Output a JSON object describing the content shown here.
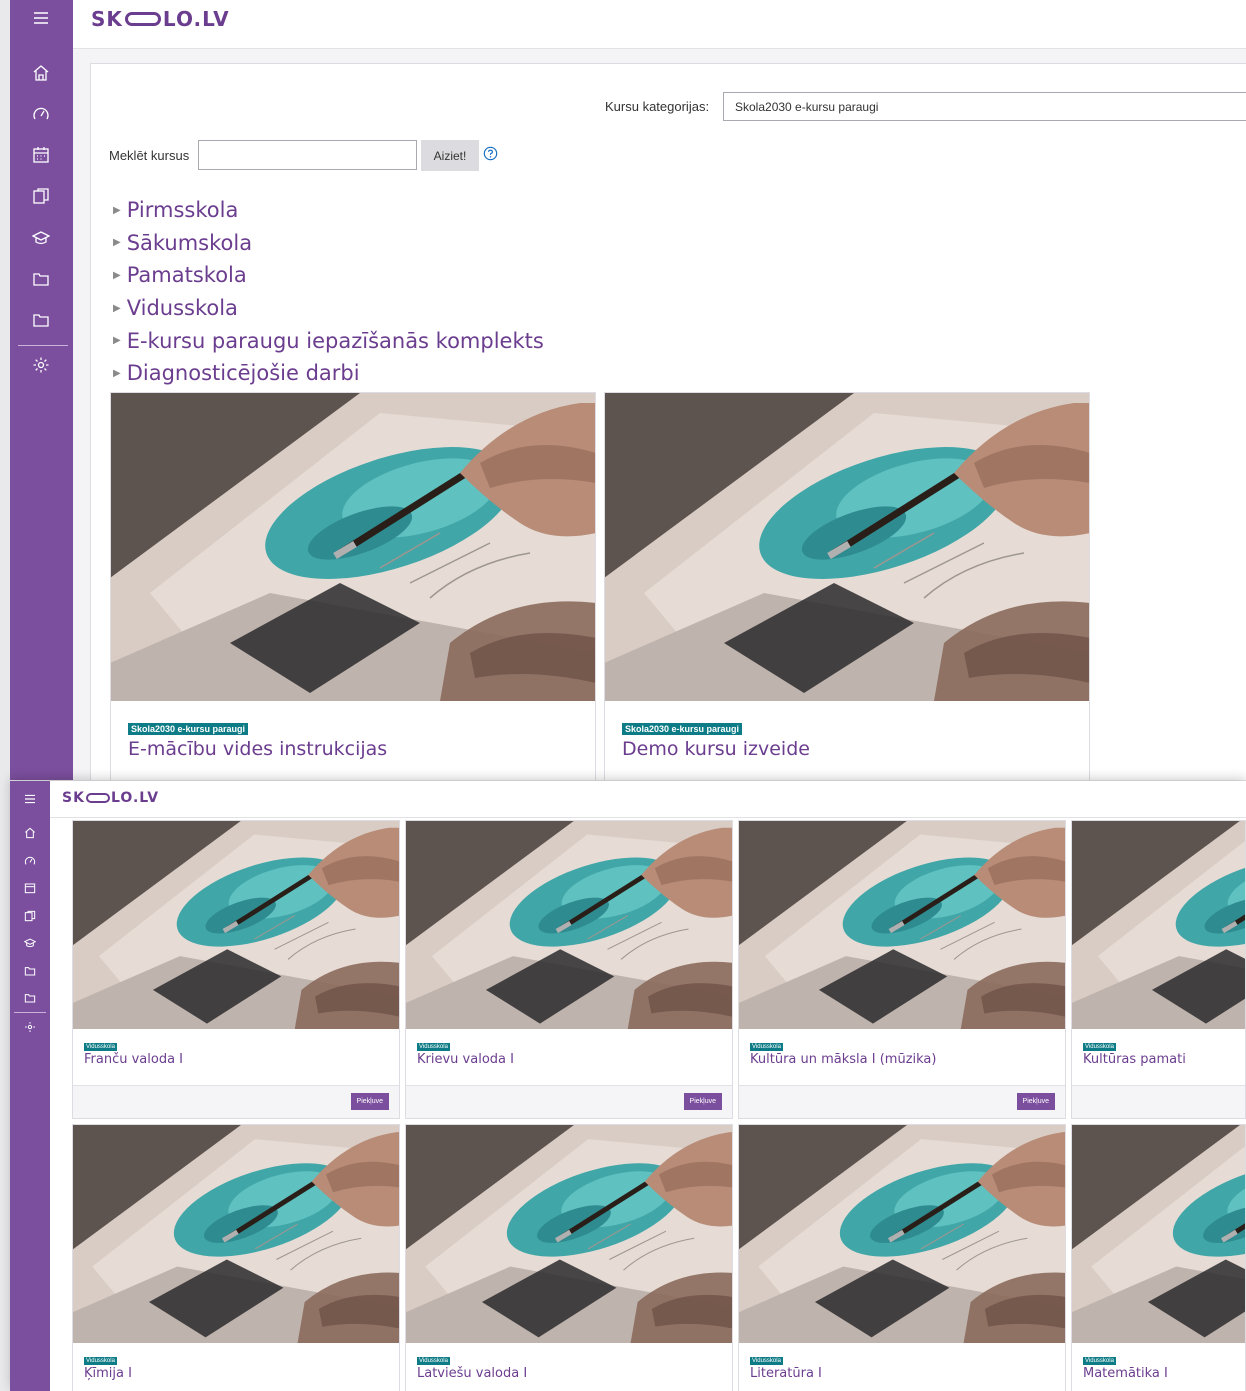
{
  "brand": {
    "left": "SK",
    "right": "LO.LV",
    "color": "#6b3d8f"
  },
  "colors": {
    "sidebar": "#7b4f9e",
    "badge": "#0e7c86",
    "accent": "#6b3d8f"
  },
  "sidebar_icons": [
    "menu-icon",
    "home-icon",
    "dashboard-icon",
    "calendar-icon",
    "files-icon",
    "graduation-cap-icon",
    "folder-icon",
    "folder-icon",
    "gear-icon"
  ],
  "filter": {
    "category_label": "Kursu kategorijas:",
    "category_value": "Skola2030 e-kursu paraugi"
  },
  "search": {
    "label": "Meklēt kursus",
    "value": "",
    "button": "Aiziet!"
  },
  "categories": [
    "Pirmsskola",
    "Sākumskola",
    "Pamatskola",
    "Vidusskola",
    "E-kursu paraugu iepazīšanās komplekts",
    "Diagnosticējošie darbi"
  ],
  "featured_courses": [
    {
      "badge": "Skola2030 e-kursu paraugi",
      "title": "E-mācību vides instrukcijas"
    },
    {
      "badge": "Skola2030 e-kursu paraugi",
      "title": "Demo kursu izveide"
    }
  ],
  "courses_row1": [
    {
      "badge": "Vidusskola",
      "title": "Franču valoda I",
      "button": "Piekļuve"
    },
    {
      "badge": "Vidusskola",
      "title": "Krievu valoda I",
      "button": "Piekļuve"
    },
    {
      "badge": "Vidusskola",
      "title": "Kultūra un māksla I (mūzika)",
      "button": "Piekļuve"
    },
    {
      "badge": "Vidusskola",
      "title": "Kultūras pamati",
      "button": ""
    }
  ],
  "courses_row2": [
    {
      "badge": "Vidusskola",
      "title": "Ķīmija I"
    },
    {
      "badge": "Vidusskola",
      "title": "Latviešu valoda I"
    },
    {
      "badge": "Vidusskola",
      "title": "Literatūra I"
    },
    {
      "badge": "Vidusskola",
      "title": "Matemātika I"
    }
  ]
}
